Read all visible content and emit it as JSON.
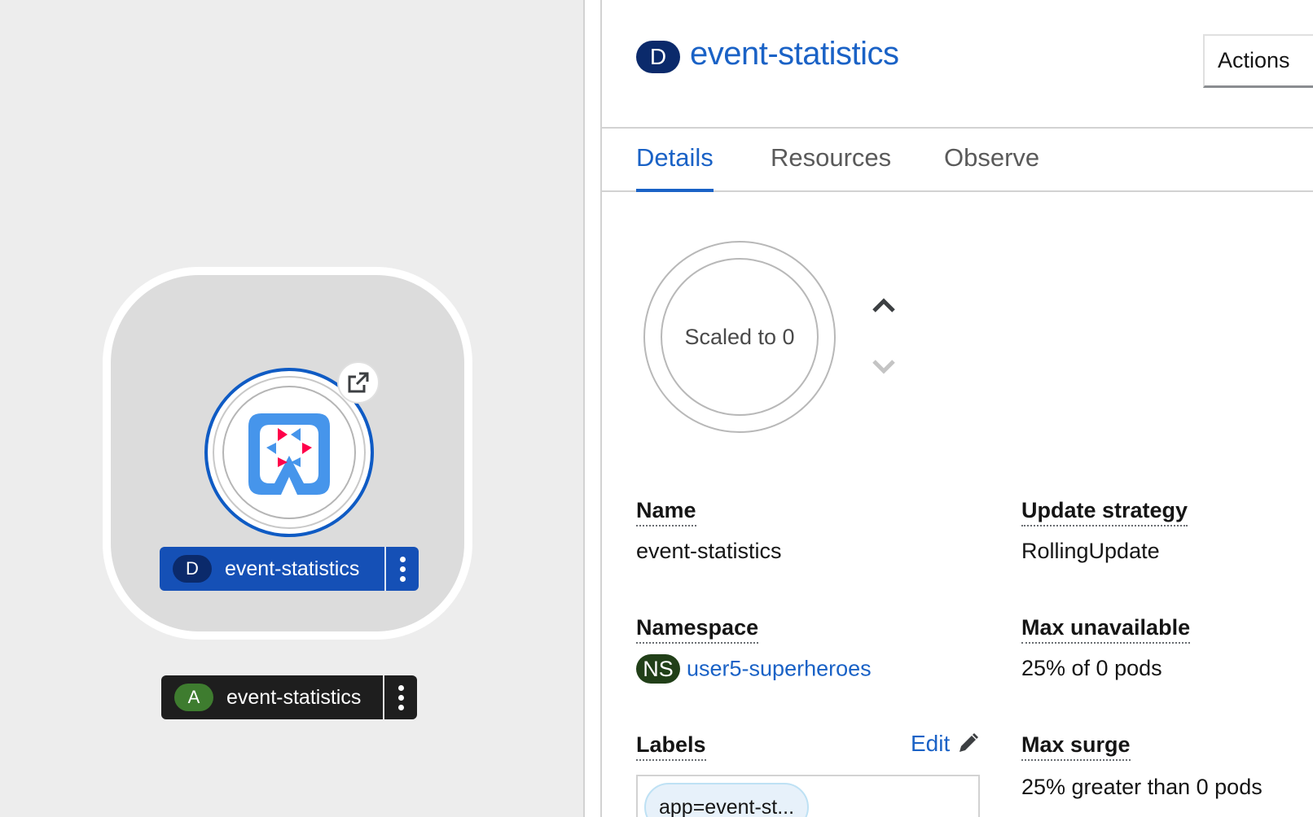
{
  "topology": {
    "deployment_node": {
      "badge": "D",
      "name": "event-statistics"
    },
    "application_group": {
      "badge": "A",
      "name": "event-statistics"
    },
    "icons": {
      "external_link": "external-link-icon",
      "quarkus_logo": "quarkus-logo-icon",
      "kebab": "kebab-menu-icon"
    }
  },
  "panel": {
    "badge": "D",
    "title": "event-statistics",
    "actions_label": "Actions",
    "tabs": [
      {
        "label": "Details",
        "active": true
      },
      {
        "label": "Resources",
        "active": false
      },
      {
        "label": "Observe",
        "active": false
      }
    ],
    "pod_status": "Scaled to 0",
    "details": {
      "name_label": "Name",
      "name_value": "event-statistics",
      "namespace_label": "Namespace",
      "namespace_badge": "NS",
      "namespace_value": "user5-superheroes",
      "labels_label": "Labels",
      "edit_label": "Edit",
      "label_chip": "app=event-st...",
      "update_strategy_label": "Update strategy",
      "update_strategy_value": "RollingUpdate",
      "max_unavailable_label": "Max unavailable",
      "max_unavailable_value": "25% of 0 pods",
      "max_surge_label": "Max surge",
      "max_surge_value": "25% greater than 0 pods"
    }
  },
  "colors": {
    "link_blue": "#1a62c6",
    "deployment_badge": "#0b2a6b",
    "app_badge": "#3e7c2f",
    "namespace_badge": "#213f18",
    "node_label_blue": "#1550b6",
    "node_label_dark": "#1e1e1e"
  }
}
